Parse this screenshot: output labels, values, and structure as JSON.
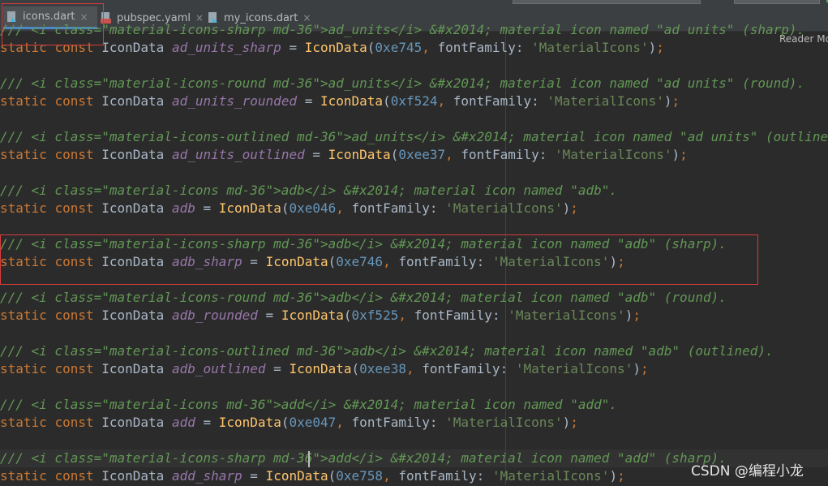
{
  "tabs": [
    {
      "label": "icons.dart",
      "icon": "dart-file-icon",
      "active": true
    },
    {
      "label": "pubspec.yaml",
      "icon": "yaml-file-icon",
      "active": false
    },
    {
      "label": "my_icons.dart",
      "icon": "dart-file-icon",
      "active": false
    }
  ],
  "tab_close_glyph": "×",
  "reader_mode_label": "Reader Mo",
  "watermark": "CSDN @编程小龙",
  "code": {
    "static": "static",
    "const": "const",
    "type": "IconData",
    "ctor": "IconData",
    "font_key": "fontFamily",
    "font_val": "'MaterialIcons'",
    "blocks": [
      {
        "comment": "/// <i class=\"material-icons-sharp md-36\">ad_units</i> &#x2014; material icon named \"ad units\" (sharp).",
        "name": "ad_units_sharp",
        "hex": "0xe745"
      },
      {
        "comment": "/// <i class=\"material-icons-round md-36\">ad_units</i> &#x2014; material icon named \"ad units\" (round).",
        "name": "ad_units_rounded",
        "hex": "0xf524"
      },
      {
        "comment": "/// <i class=\"material-icons-outlined md-36\">ad_units</i> &#x2014; material icon named \"ad units\" (outlined).",
        "name": "ad_units_outlined",
        "hex": "0xee37"
      },
      {
        "comment": "/// <i class=\"material-icons md-36\">adb</i> &#x2014; material icon named \"adb\".",
        "name": "adb",
        "hex": "0xe046"
      },
      {
        "comment": "/// <i class=\"material-icons-sharp md-36\">adb</i> &#x2014; material icon named \"adb\" (sharp).",
        "name": "adb_sharp",
        "hex": "0xe746"
      },
      {
        "comment": "/// <i class=\"material-icons-round md-36\">adb</i> &#x2014; material icon named \"adb\" (round).",
        "name": "adb_rounded",
        "hex": "0xf525"
      },
      {
        "comment": "/// <i class=\"material-icons-outlined md-36\">adb</i> &#x2014; material icon named \"adb\" (outlined).",
        "name": "adb_outlined",
        "hex": "0xee38"
      },
      {
        "comment": "/// <i class=\"material-icons md-36\">add</i> &#x2014; material icon named \"add\".",
        "name": "add",
        "hex": "0xe047"
      },
      {
        "comment": "/// <i class=\"material-icons-sharp md-36\">add</i> &#x2014; material icon named \"add\" (sharp).",
        "name": "add_sharp",
        "hex": "0xe758"
      }
    ]
  },
  "colors": {
    "comment": "#629755",
    "keyword": "#cc7832",
    "identifier": "#9876aa",
    "function": "#ffc66d",
    "number": "#6897bb",
    "string": "#6a8759",
    "annotation_box": "#d83b3b"
  }
}
